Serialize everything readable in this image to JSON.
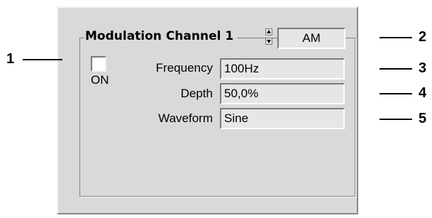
{
  "group": {
    "title": "Modulation Channel 1"
  },
  "mode": {
    "value": "AM"
  },
  "on_checkbox": {
    "label": "ON",
    "checked": false
  },
  "fields": [
    {
      "label": "Frequency",
      "value": "100Hz"
    },
    {
      "label": "Depth",
      "value": "50,0%"
    },
    {
      "label": "Waveform",
      "value": "Sine"
    }
  ],
  "callouts": [
    "1",
    "2",
    "3",
    "4",
    "5"
  ]
}
